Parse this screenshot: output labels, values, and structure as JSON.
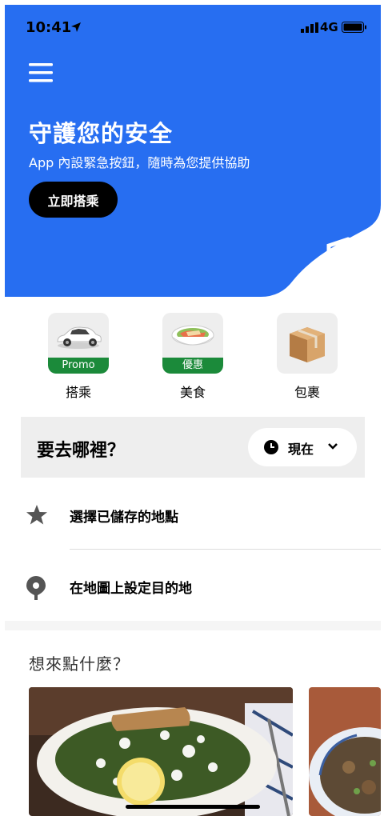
{
  "status_bar": {
    "time": "10:41",
    "network": "4G"
  },
  "hero": {
    "title": "守護您的安全",
    "subtitle": "App 內設緊急按鈕，隨時為您提供協助",
    "cta_label": "立即搭乘",
    "background_color": "#276EF1"
  },
  "services": [
    {
      "label": "搭乘",
      "badge": "Promo",
      "icon": "car-icon"
    },
    {
      "label": "美食",
      "badge": "優惠",
      "icon": "food-bowl-icon"
    },
    {
      "label": "包裹",
      "badge": "",
      "icon": "package-icon"
    }
  ],
  "where_to": {
    "question": "要去哪裡？",
    "time_selector": "現在"
  },
  "shortcuts": [
    {
      "label": "選擇已儲存的地點",
      "icon": "star-icon"
    },
    {
      "label": "在地圖上設定目的地",
      "icon": "map-pin-icon"
    }
  ],
  "food_section": {
    "title": "想來點什麼？"
  },
  "colors": {
    "badge_green": "#1b8a3a",
    "brand_blue": "#276EF1"
  }
}
